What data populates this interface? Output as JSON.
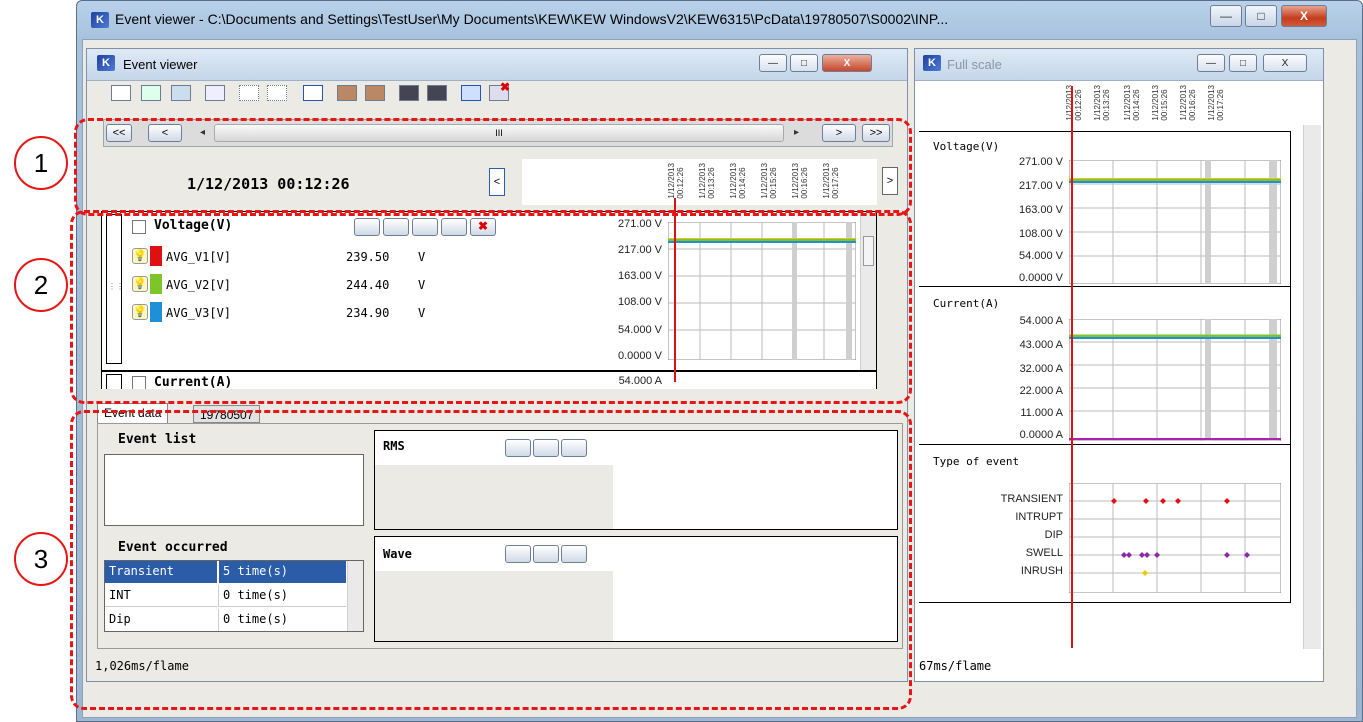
{
  "main_window": {
    "title": "Event viewer - C:\\Documents and Settings\\TestUser\\My Documents\\KEW\\KEW WindowsV2\\KEW6315\\PcData\\19780507\\S0002\\INP...",
    "minimize": "—",
    "maximize": "□",
    "close": "X"
  },
  "event_viewer": {
    "title": "Event viewer",
    "nav": {
      "first": "<<",
      "prev": "<",
      "scroll_left": "◂",
      "scroll_mid": "III",
      "scroll_right": "▸",
      "next": ">",
      "last": ">>"
    },
    "datetime": "1/12/2013 00:12:26",
    "time_ticks": [
      "1/12/2013\n00:12:26",
      "1/12/2013\n00:13:26",
      "1/12/2013\n00:14:26",
      "1/12/2013\n00:15:26",
      "1/12/2013\n00:16:26",
      "1/12/2013\n00:17:26"
    ],
    "time_prev": "<",
    "time_next": ">",
    "voltage_group": {
      "title": "Voltage(V)",
      "channels": [
        {
          "name": "AVG_V1[V]",
          "value": "239.50",
          "unit": "V",
          "color": "#e01010"
        },
        {
          "name": "AVG_V2[V]",
          "value": "244.40",
          "unit": "V",
          "color": "#7cc52a"
        },
        {
          "name": "AVG_V3[V]",
          "value": "234.90",
          "unit": "V",
          "color": "#1e8fd8"
        }
      ],
      "yticks": [
        "271.00 V",
        "217.00 V",
        "163.00 V",
        "108.00 V",
        "54.000 V",
        "0.0000 V"
      ]
    },
    "current_group": {
      "title": "Current(A)",
      "first_tick": "54.000 A"
    },
    "tabs": [
      "Event data",
      "19780507"
    ],
    "event_list_label": "Event list",
    "rms_label": "RMS",
    "wave_label": "Wave",
    "event_occurred_label": "Event occurred",
    "event_occurred_rows": [
      {
        "type": "Transient",
        "count": "5 time(s)"
      },
      {
        "type": "INT",
        "count": "0 time(s)"
      },
      {
        "type": "Dip",
        "count": "0 time(s)"
      }
    ],
    "status": "1,026ms/flame"
  },
  "full_scale": {
    "title": "Full scale",
    "time_ticks": [
      "1/12/2013\n00:12:26",
      "1/12/2013\n00:13:26",
      "1/12/2013\n00:14:26",
      "1/12/2013\n00:15:26",
      "1/12/2013\n00:16:26",
      "1/12/2013\n00:17:26"
    ],
    "voltage": {
      "title": "Voltage(V)",
      "yticks": [
        "271.00 V",
        "217.00 V",
        "163.00 V",
        "108.00 V",
        "54.000 V",
        "0.0000 V"
      ]
    },
    "current": {
      "title": "Current(A)",
      "yticks": [
        "54.000 A",
        "43.000 A",
        "32.000 A",
        "22.000 A",
        "11.000 A",
        "0.0000 A"
      ]
    },
    "events": {
      "title": "Type of event",
      "types": [
        "TRANSIENT",
        "INTRUPT",
        "DIP",
        "SWELL",
        "INRUSH"
      ]
    },
    "status": "67ms/flame"
  },
  "annotations": [
    "1",
    "2",
    "3"
  ],
  "colors": {
    "accent_red": "#e81515",
    "transient": "#e01010",
    "swell": "#8a2aa8",
    "inrush": "#f0c800"
  }
}
